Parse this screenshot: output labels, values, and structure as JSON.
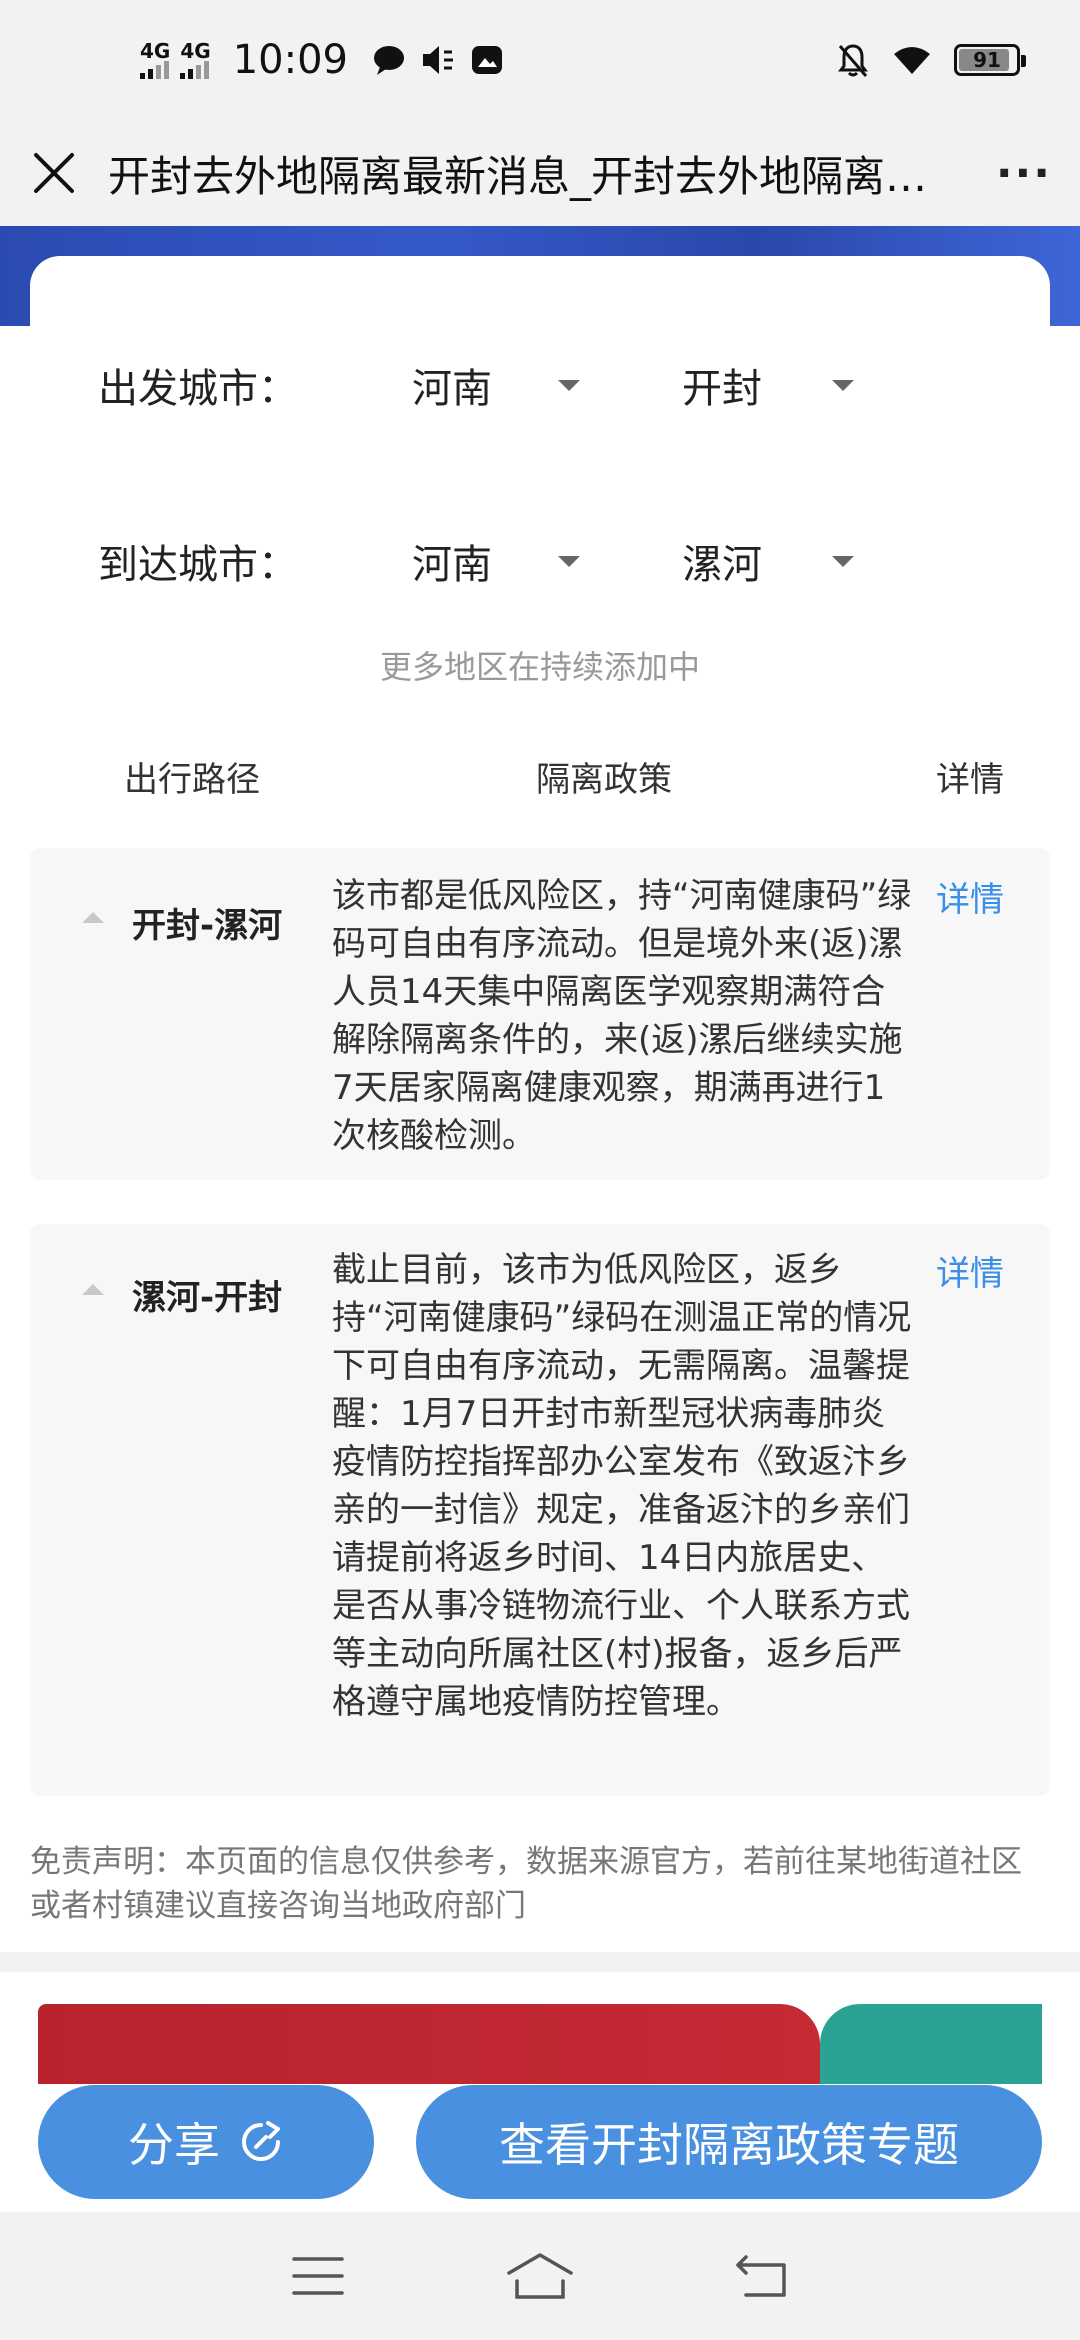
{
  "status_bar": {
    "network_1": "4G",
    "network_2": "4G",
    "time": "10:09",
    "battery": "91"
  },
  "title_bar": {
    "title": "开封去外地隔离最新消息_开封去外地隔离政策",
    "more": "···"
  },
  "selector": {
    "departure": {
      "label": "出发城市：",
      "province": "河南",
      "city": "开封"
    },
    "arrival": {
      "label": "到达城市：",
      "province": "河南",
      "city": "漯河"
    }
  },
  "more_hint": "更多地区在持续添加中",
  "table_header": {
    "route": "出行路径",
    "policy": "隔离政策",
    "detail": "详情"
  },
  "routes": [
    {
      "name": "开封-漯河",
      "policy": "该市都是低风险区，持“河南健康码”绿码可自由有序流动。但是境外来(返)漯人员14天集中隔离医学观察期满符合解除隔离条件的，来(返)漯后继续实施7天居家隔离健康观察，期满再进行1次核酸检测。",
      "detail": "详情"
    },
    {
      "name": "漯河-开封",
      "policy": "截止目前，该市为低风险区，返乡持“河南健康码”绿码在测温正常的情况下可自由有序流动，无需隔离。温馨提醒：1月7日开封市新型冠状病毒肺炎疫情防控指挥部办公室发布《致返汴乡亲的一封信》规定，准备返汴的乡亲们请提前将返乡时间、14日内旅居史、是否从事冷链物流行业、个人联系方式等主动向所属社区(村)报备，返乡后严格遵守属地疫情防控管理。",
      "detail": "详情"
    }
  ],
  "disclaimer": "免责声明：本页面的信息仅供参考，数据来源官方，若前往某地街道社区或者村镇建议直接咨询当地政府部门",
  "buttons": {
    "share": "分享",
    "topic": "查看开封隔离政策专题"
  },
  "colors": {
    "accent": "#4a90e0",
    "link": "#3a8ee6",
    "banner": "#2b4bb3"
  }
}
